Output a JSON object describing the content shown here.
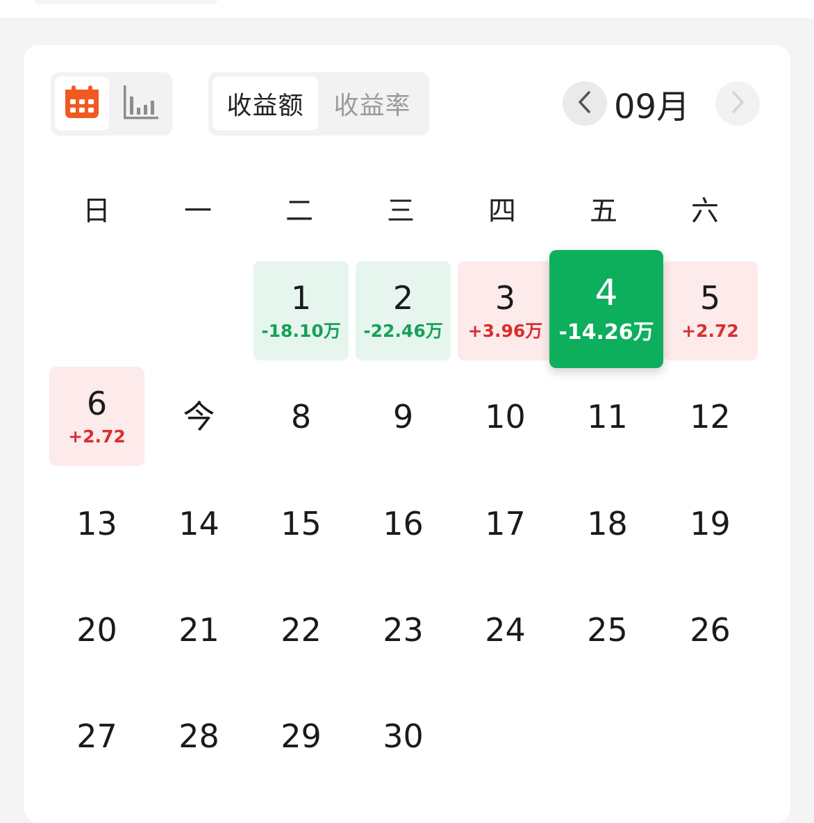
{
  "header": {
    "view_switch": {
      "calendar_icon": "calendar-icon",
      "chart_icon": "bar-chart-icon",
      "active": "calendar"
    },
    "metric_toggle": {
      "active_label": "收益额",
      "inactive_label": "收益率"
    },
    "month_nav": {
      "label": "09月",
      "prev_icon": "chevron-left-icon",
      "next_icon": "chevron-right-icon"
    }
  },
  "weekdays": [
    "日",
    "一",
    "二",
    "三",
    "四",
    "五",
    "六"
  ],
  "days": [
    {
      "num": "1",
      "value": "-18.10万",
      "tone": "neg"
    },
    {
      "num": "2",
      "value": "-22.46万",
      "tone": "neg"
    },
    {
      "num": "3",
      "value": "+3.96万",
      "tone": "pos"
    },
    {
      "num": "4",
      "value": "-14.26万",
      "tone": "selected"
    },
    {
      "num": "5",
      "value": "+2.72",
      "tone": "pos"
    },
    {
      "num": "6",
      "value": "+2.72",
      "tone": "pos"
    },
    {
      "num": "今"
    },
    {
      "num": "8"
    },
    {
      "num": "9"
    },
    {
      "num": "10"
    },
    {
      "num": "11"
    },
    {
      "num": "12"
    },
    {
      "num": "13"
    },
    {
      "num": "14"
    },
    {
      "num": "15"
    },
    {
      "num": "16"
    },
    {
      "num": "17"
    },
    {
      "num": "18"
    },
    {
      "num": "19"
    },
    {
      "num": "20"
    },
    {
      "num": "21"
    },
    {
      "num": "22"
    },
    {
      "num": "23"
    },
    {
      "num": "24"
    },
    {
      "num": "25"
    },
    {
      "num": "26"
    },
    {
      "num": "27"
    },
    {
      "num": "28"
    },
    {
      "num": "29"
    },
    {
      "num": "30"
    }
  ],
  "colors": {
    "gain": "#d92e2e",
    "loss": "#16a05a",
    "selected": "#0daf5c",
    "accent": "#f05a22"
  }
}
